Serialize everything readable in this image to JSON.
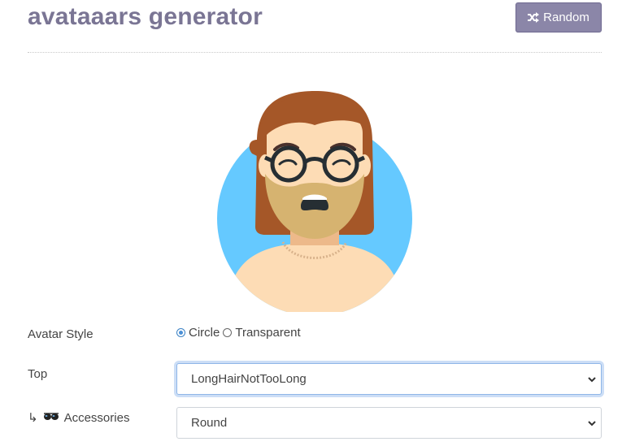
{
  "header": {
    "title": "avataaars generator",
    "random_label": "Random"
  },
  "avatar": {
    "background_color": "#65C9FF",
    "skin_color": "#FDDCB5",
    "hair_color": "#A55728",
    "beard_color": "#D6B370",
    "glasses_color": "#262E33"
  },
  "form": {
    "avatar_style": {
      "label": "Avatar Style",
      "options": [
        "Circle",
        "Transparent"
      ],
      "selected": "Circle"
    },
    "top": {
      "label": "Top",
      "value": "LongHairNotTooLong"
    },
    "accessories": {
      "prefix": "↳",
      "label": "Accessories",
      "value": "Round"
    }
  }
}
